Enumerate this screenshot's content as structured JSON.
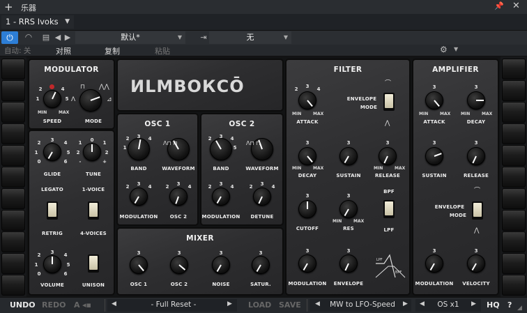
{
  "window": {
    "title": "乐器",
    "plus": "+",
    "pin": "📌",
    "close": "✕"
  },
  "instrument": {
    "selected": "1 - RRS Ivoks"
  },
  "toolbar": {
    "power": "⏻",
    "preset_name": "默认*",
    "routing": "无",
    "auto_label": "自动: 关",
    "compare": "对照",
    "copy": "复制",
    "paste": "粘贴",
    "prev": "◀",
    "next": "▶",
    "gear": "⚙"
  },
  "logo": "ИLMВОКСŌ",
  "panels": {
    "modulator": {
      "title": "MODULATOR",
      "speed": "SPEED",
      "mode": "MODE"
    },
    "osc1": {
      "title": "OSC 1",
      "band": "BAND",
      "waveform": "WAVEFORM",
      "modulation": "MODULATION",
      "osc2": "OSC 2"
    },
    "osc2": {
      "title": "OSC 2",
      "band": "BAND",
      "waveform": "WAVEFORM",
      "modulation": "MODULATION",
      "detune": "DETUNE"
    },
    "voice": {
      "glide": "GLIDE",
      "tune": "TUNE",
      "legato": "LEGATO",
      "voice1": "1-VOICE",
      "retrig": "RETRIG",
      "voices4": "4-VOICES",
      "volume": "VOLUME",
      "unison": "UNISON"
    },
    "mixer": {
      "title": "MIXER",
      "osc1": "OSC 1",
      "osc2": "OSC 2",
      "noise": "NOISE",
      "satur": "SATUR."
    },
    "filter": {
      "title": "FILTER",
      "attack": "ATTACK",
      "envmode": "ENVELOPE",
      "mode": "MODE",
      "decay": "DECAY",
      "sustain": "SUSTAIN",
      "release": "RELEASE",
      "bpf": "BPF",
      "lpf": "LPF",
      "cutoff": "CUTOFF",
      "res": "RES",
      "modulation": "MODULATION",
      "envelope": "ENVELOPE",
      "lpf_small": "LPF",
      "bpf_small": "BPF"
    },
    "amplifier": {
      "title": "AMPLIFIER",
      "attack": "ATTACK",
      "decay": "DECAY",
      "sustain": "SUSTAIN",
      "release": "RELEASE",
      "envmode": "ENVELOPE",
      "mode": "MODE",
      "modulation": "MODULATION",
      "velocity": "VELOCITY"
    }
  },
  "scale": {
    "n0": "0",
    "n1": "1",
    "n2": "2",
    "n3": "3",
    "n4": "4",
    "n5": "5",
    "n6": "6",
    "min": "MIN",
    "max": "MAX",
    "minus": "-",
    "plus": "+"
  },
  "bottom": {
    "undo": "UNDO",
    "redo": "REDO",
    "a": "A",
    "preset": "- Full Reset -",
    "load": "LOAD",
    "save": "SAVE",
    "midi": "MW to LFO-Speed",
    "os": "OS x1",
    "hq": "HQ",
    "help": "?",
    "left": "◀",
    "right": "▶"
  }
}
